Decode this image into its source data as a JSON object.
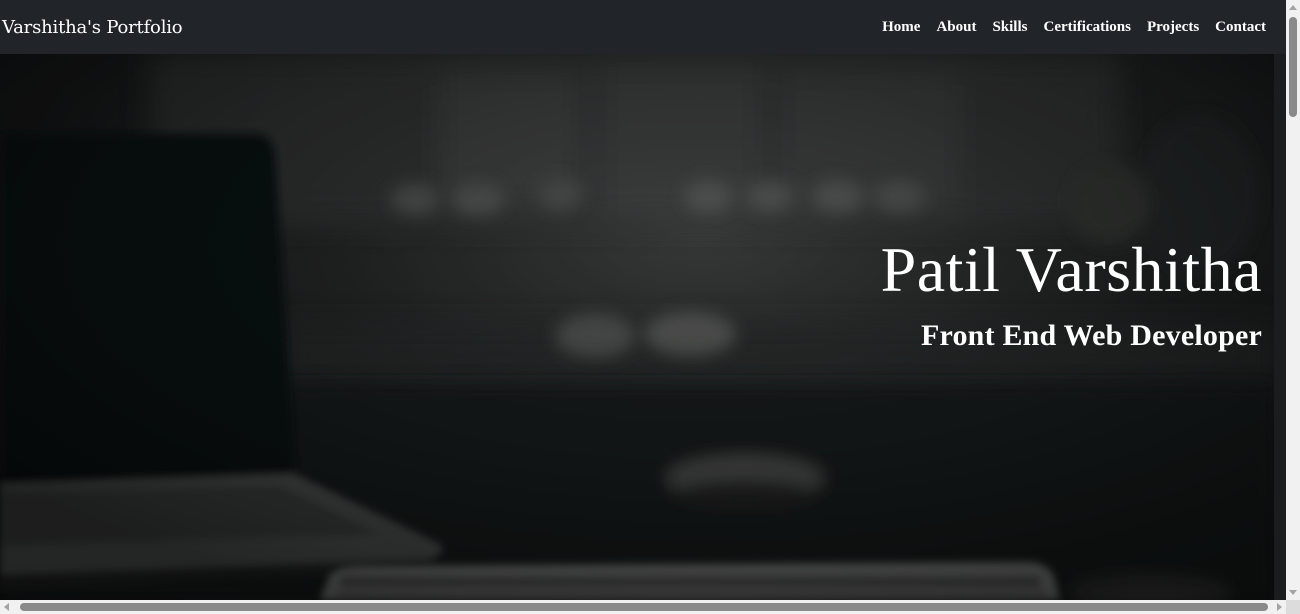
{
  "navbar": {
    "brand": "Varshitha's Portfolio",
    "links": [
      "Home",
      "About",
      "Skills",
      "Certifications",
      "Projects",
      "Contact"
    ]
  },
  "hero": {
    "name": "Patil Varshitha",
    "role": "Front End Web Developer"
  },
  "colors": {
    "navbar_bg": "#212529",
    "text": "#ffffff",
    "scrollbar_track": "#f1f1f1",
    "scrollbar_thumb": "#8a8a8a"
  }
}
